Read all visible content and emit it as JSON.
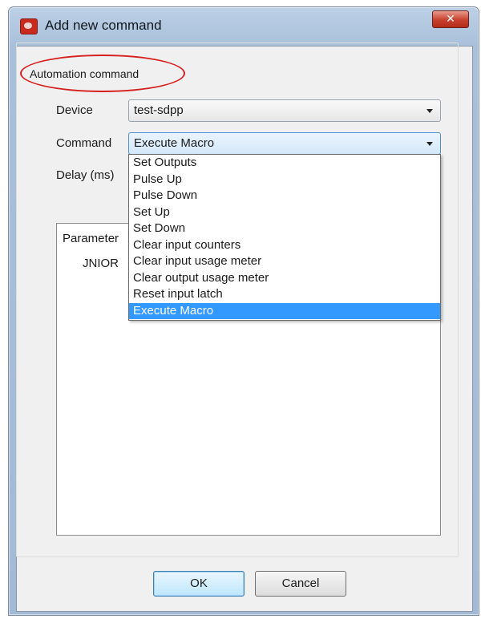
{
  "window": {
    "title": "Add new command",
    "close_label": "✕"
  },
  "group": {
    "label": "Automation command"
  },
  "fields": {
    "device_label": "Device",
    "device_value": "test-sdpp",
    "command_label": "Command",
    "command_value": "Execute Macro",
    "delay_label": "Delay (ms)"
  },
  "dropdown": {
    "options": [
      "Set Outputs",
      "Pulse Up",
      "Pulse Down",
      "Set Up",
      "Set Down",
      "Clear input counters",
      "Clear input usage meter",
      "Clear output usage meter",
      "Reset input latch",
      "Execute Macro"
    ],
    "selected": "Execute Macro"
  },
  "parameters": {
    "header": "Parameter",
    "device_text": "JNIOR"
  },
  "buttons": {
    "ok": "OK",
    "cancel": "Cancel"
  },
  "colors": {
    "selection": "#3399ff",
    "annotation": "#d62020",
    "close_button": "#c8402d"
  }
}
